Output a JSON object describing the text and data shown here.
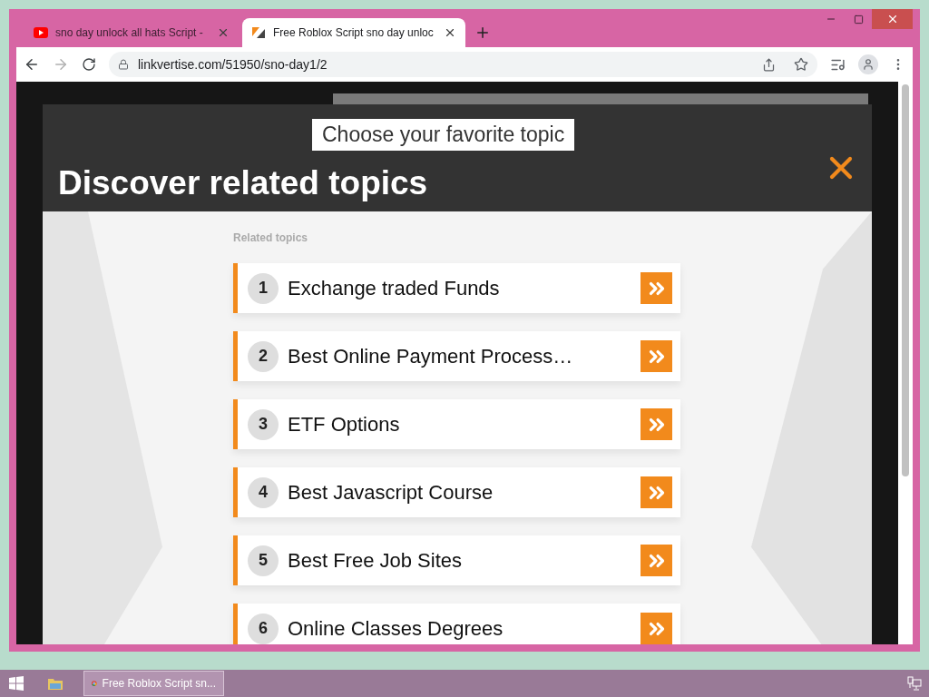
{
  "browser": {
    "tabs": [
      {
        "title": "sno day unlock all hats Script -",
        "selected": false,
        "kind": "video"
      },
      {
        "title": "Free Roblox Script sno day unloc",
        "selected": true,
        "kind": "site"
      }
    ],
    "url": "linkvertise.com/51950/sno-day1/2"
  },
  "modal": {
    "badge": "Choose your favorite topic",
    "title": "Discover related topics",
    "section_label": "Related topics",
    "topics": [
      {
        "number": "1",
        "label": "Exchange traded Funds"
      },
      {
        "number": "2",
        "label": "Best Online Payment Process…"
      },
      {
        "number": "3",
        "label": "ETF Options"
      },
      {
        "number": "4",
        "label": "Best Javascript Course"
      },
      {
        "number": "5",
        "label": "Best Free Job Sites"
      },
      {
        "number": "6",
        "label": "Online Classes Degrees"
      }
    ]
  },
  "taskbar": {
    "task": "Free Roblox Script sn..."
  }
}
